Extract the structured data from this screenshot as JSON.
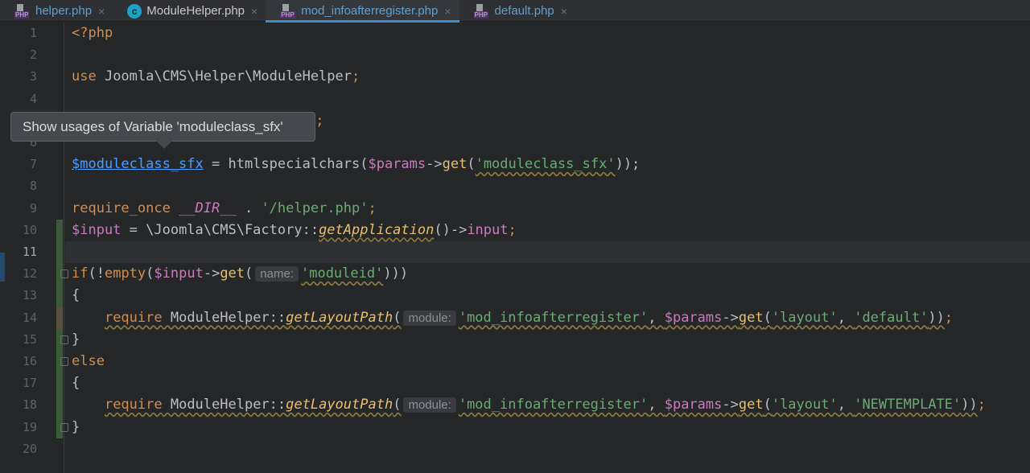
{
  "tabs": [
    {
      "label": "helper.php",
      "icon": "php-file-icon",
      "active": false
    },
    {
      "label": "ModuleHelper.php",
      "icon": "class-icon",
      "active": false
    },
    {
      "label": "mod_infoafterregister.php",
      "icon": "php-file-icon",
      "active": true
    },
    {
      "label": "default.php",
      "icon": "php-file-icon",
      "active": false
    }
  ],
  "close_glyph": "×",
  "current_line": 11,
  "tooltip": "Show usages of Variable 'moduleclass_sfx'",
  "colors": {
    "keyword": "#cf8e4d",
    "variable": "#c77dbb",
    "string": "#6aab73",
    "function": "#e8c06a",
    "link": "#4a9eff",
    "background": "#262729"
  },
  "lines": [
    [
      [
        "kw",
        "<?php"
      ]
    ],
    [],
    [
      [
        "kw",
        "use "
      ],
      [
        "def",
        "Joomla\\CMS\\Helper\\ModuleHelper"
      ],
      [
        "kw",
        ";"
      ]
    ],
    [],
    [
      [
        "kw",
        "e;"
      ]
    ],
    [],
    [
      [
        "lnk",
        "$moduleclass_sfx"
      ],
      [
        "def",
        " = htmlspecialchars("
      ],
      [
        "var",
        "$params"
      ],
      [
        "def",
        "->"
      ],
      [
        "fn",
        "get"
      ],
      [
        "def",
        "("
      ],
      [
        "str wavy",
        "'moduleclass_sfx'"
      ],
      [
        "def",
        "));"
      ]
    ],
    [],
    [
      [
        "kw",
        "require_once "
      ],
      [
        "cns",
        "__DIR__"
      ],
      [
        "def",
        " . "
      ],
      [
        "str",
        "'/helper.php'"
      ],
      [
        "kw",
        ";"
      ]
    ],
    [
      [
        "var",
        "$input"
      ],
      [
        "def",
        " = \\Joomla\\CMS\\Factory::"
      ],
      [
        "fni wavy",
        "getApplication"
      ],
      [
        "def",
        "()->"
      ],
      [
        "var",
        "input"
      ],
      [
        "kw",
        ";"
      ]
    ],
    [],
    [
      [
        "kw",
        "if"
      ],
      [
        "def",
        "(!"
      ],
      [
        "kw",
        "empty"
      ],
      [
        "def",
        "("
      ],
      [
        "var",
        "$input"
      ],
      [
        "def",
        "->"
      ],
      [
        "fn",
        "get"
      ],
      [
        "def",
        "("
      ],
      [
        "hint",
        "name:"
      ],
      [
        "str wavy",
        "'moduleid'"
      ],
      [
        "def",
        ")))"
      ]
    ],
    [
      [
        "def",
        "{"
      ]
    ],
    [
      [
        "def",
        "    "
      ],
      [
        "kw wavy",
        "require"
      ],
      [
        "def wavy",
        " ModuleHelper::"
      ],
      [
        "fni wavy",
        "getLayoutPath"
      ],
      [
        "def wavy",
        "("
      ],
      [
        "hint",
        "module:"
      ],
      [
        "str wavy",
        "'mod_infoafterregister'"
      ],
      [
        "def wavy",
        ", "
      ],
      [
        "var wavy",
        "$params"
      ],
      [
        "def wavy",
        "->"
      ],
      [
        "fn wavy",
        "get"
      ],
      [
        "def wavy",
        "("
      ],
      [
        "str wavy",
        "'layout'"
      ],
      [
        "def wavy",
        ", "
      ],
      [
        "str wavy",
        "'default'"
      ],
      [
        "def wavy",
        "))"
      ],
      [
        "kw",
        ";"
      ]
    ],
    [
      [
        "def",
        "}"
      ]
    ],
    [
      [
        "kw",
        "else"
      ]
    ],
    [
      [
        "def",
        "{"
      ]
    ],
    [
      [
        "def",
        "    "
      ],
      [
        "kw wavy",
        "require"
      ],
      [
        "def wavy",
        " ModuleHelper::"
      ],
      [
        "fni wavy",
        "getLayoutPath"
      ],
      [
        "def wavy",
        "("
      ],
      [
        "hint",
        "module:"
      ],
      [
        "str wavy",
        "'mod_infoafterregister'"
      ],
      [
        "def wavy",
        ", "
      ],
      [
        "var wavy",
        "$params"
      ],
      [
        "def wavy",
        "->"
      ],
      [
        "fn wavy",
        "get"
      ],
      [
        "def wavy",
        "("
      ],
      [
        "str wavy",
        "'layout'"
      ],
      [
        "def wavy",
        ", "
      ],
      [
        "str wavy",
        "'NEWTEMPLATE'"
      ],
      [
        "def wavy",
        "))"
      ],
      [
        "kw",
        ";"
      ]
    ],
    [
      [
        "def",
        "}"
      ]
    ],
    []
  ]
}
